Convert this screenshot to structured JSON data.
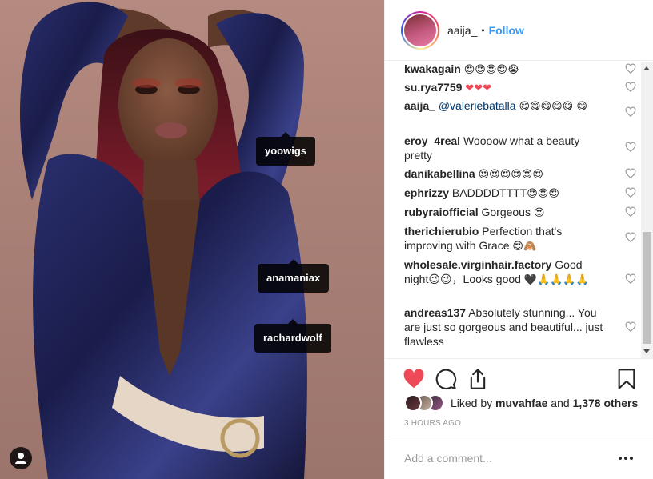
{
  "post": {
    "tags": [
      {
        "id": "tag-yoowigs",
        "label": "yoowigs"
      },
      {
        "id": "tag-anamaniax",
        "label": "anamaniax"
      },
      {
        "id": "tag-rachardwolf",
        "label": "rachardwolf"
      }
    ]
  },
  "header": {
    "username": "aaija_",
    "separator": "•",
    "follow_label": "Follow"
  },
  "comments": [
    {
      "user": "kwakagain",
      "text": "",
      "emoji": "😍😍😍😍😭"
    },
    {
      "user": "su.rya7759",
      "text": "",
      "emoji": "❤❤❤"
    },
    {
      "user": "aaija_",
      "mention": "@valeriebatalla",
      "text": "",
      "emoji": "😋😋😋😋😋 😋"
    },
    {
      "user": "eroy_4real",
      "text": "Woooow what a beauty pretty",
      "emoji": ""
    },
    {
      "user": "danikabellina",
      "text": "",
      "emoji": "😍😍😍😍😍😍"
    },
    {
      "user": "ephrizzy",
      "text": "BADDDDTTTT",
      "emoji": "😍😍😍"
    },
    {
      "user": "rubyraiofficial",
      "text": "Gorgeous",
      "emoji": "😍"
    },
    {
      "user": "therichierubio",
      "text": "Perfection that's improving with Grace",
      "emoji": "😍🙈"
    },
    {
      "user": "wholesale.virginhair.factory",
      "text": "Good night😉😉，Looks good",
      "emoji": "🖤🙏🙏🙏🙏"
    },
    {
      "user": "andreas137",
      "text": "Absolutely stunning... You are just so gorgeous and beautiful... just flawless",
      "emoji": ""
    }
  ],
  "likes": {
    "prefix": "Liked by",
    "user": "muvahfae",
    "conjunction": "and",
    "others": "1,378 others"
  },
  "timestamp": "3 HOURS AGO",
  "add_comment": {
    "placeholder": "Add a comment..."
  },
  "icons": {
    "like": "heart-filled-icon",
    "comment": "comment-bubble-icon",
    "share": "share-icon",
    "save": "bookmark-icon",
    "user_tags": "user-icon",
    "more": "more-options-icon"
  },
  "colors": {
    "like_active": "#ed4956",
    "follow": "#3897f0",
    "mention": "#003569",
    "timestamp": "#999999"
  }
}
